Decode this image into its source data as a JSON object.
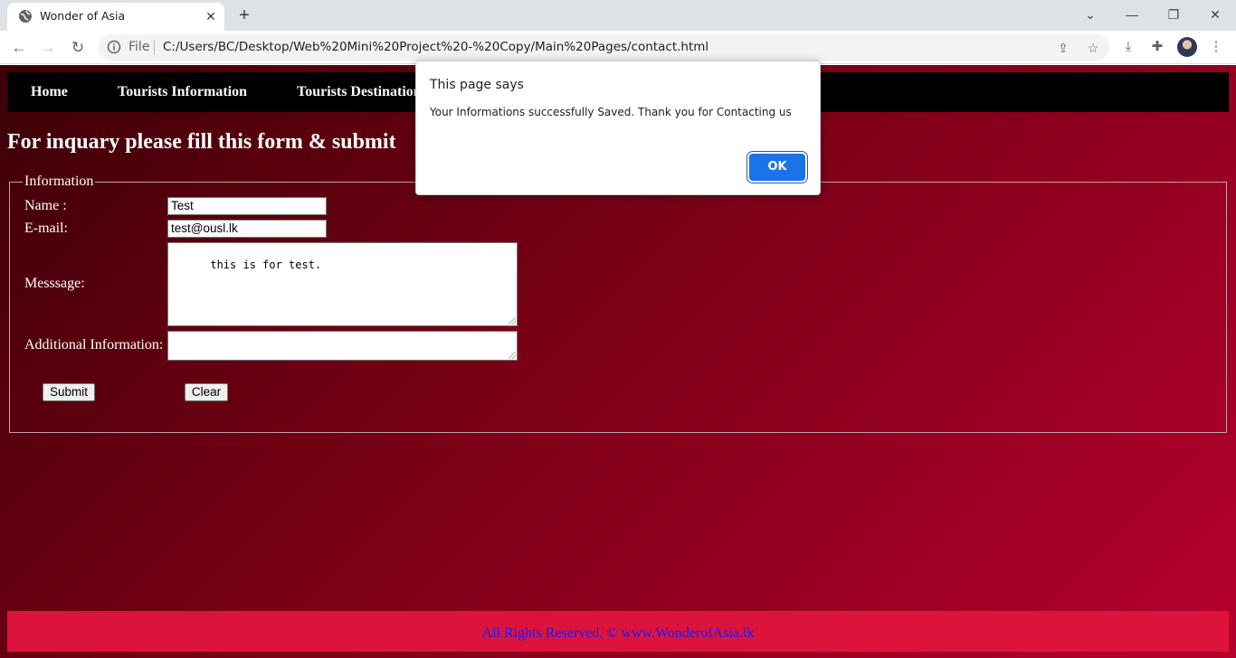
{
  "browser": {
    "tab_title": "Wonder of Asia",
    "omnibox_scheme": "File",
    "url": "C:/Users/BC/Desktop/Web%20Mini%20Project%20-%20Copy/Main%20Pages/contact.html",
    "icons": {
      "favicon": "globe-icon",
      "close_tab": "close-icon",
      "new_tab": "plus-icon",
      "back": "arrow-left-icon",
      "forward": "arrow-right-icon",
      "reload": "reload-icon",
      "site_info": "info-icon",
      "share": "share-icon",
      "bookmark": "star-icon",
      "download": "download-icon",
      "extensions": "puzzle-icon",
      "menu": "kebab-menu-icon"
    }
  },
  "nav": {
    "items": [
      {
        "label": "Home"
      },
      {
        "label": "Tourists Information"
      },
      {
        "label": "Tourists Destination"
      }
    ]
  },
  "main": {
    "heading": "For inquary please fill this form & submit",
    "legend": "Information",
    "form": {
      "name_label": "Name :",
      "name_value": "Test",
      "email_label": "E-mail:",
      "email_value": "test@ousl.lk",
      "message_label": "Messsage:",
      "message_value": "this is for test.",
      "additional_label": "Additional Information:",
      "additional_value": "",
      "submit_label": "Submit",
      "clear_label": "Clear"
    }
  },
  "footer": {
    "text": "All Rights Reserved. © www.WonderofAsia.lk"
  },
  "dialog": {
    "title": "This page says",
    "message": "Your Informations successfully Saved. Thank you for Contacting us",
    "ok_label": "OK"
  },
  "colors": {
    "navbar": "#000000",
    "footer": "#dc143c",
    "footer_text": "#1a1aff",
    "dialog_button": "#1a73e8",
    "page_gradient_start": "#3b0006",
    "page_gradient_end": "#b6002e"
  }
}
